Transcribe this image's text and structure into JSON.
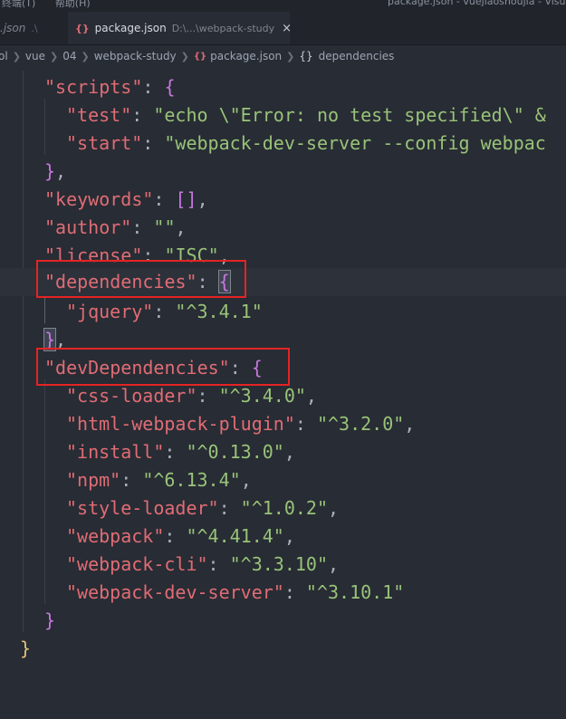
{
  "menubar": {
    "items": [
      "终端(T)",
      "帮助(H)"
    ],
    "window_title": "package.json - vuejiaoshoujia - Visual Studio Code"
  },
  "tabs": {
    "inactive": {
      "label": ".json",
      "path": ".\\"
    },
    "active": {
      "icon": "{}",
      "label": "package.json",
      "path": "D:\\...\\webpack-study",
      "close": "×"
    }
  },
  "breadcrumb": {
    "items": [
      "ol",
      "vue",
      "04",
      "webpack-study"
    ],
    "file": "package.json",
    "file_icon": "{}",
    "symbol_icon": "{}",
    "symbol": "dependencies"
  },
  "code": {
    "scripts_key": "\"scripts\"",
    "test_key": "\"test\"",
    "test_value": "\"echo \\\"Error: no test specified\\\" &",
    "start_key": "\"start\"",
    "start_value": "\"webpack-dev-server --config webpac",
    "keywords_key": "\"keywords\"",
    "author_key": "\"author\"",
    "author_value": "\"\"",
    "license_key": "\"license\"",
    "license_value": "\"ISC\"",
    "dependencies_key": "\"dependencies\"",
    "jquery_key": "\"jquery\"",
    "jquery_value": "\"^3.4.1\"",
    "devdeps_key": "\"devDependencies\"",
    "dev": [
      {
        "key": "\"css-loader\"",
        "value": "\"^3.4.0\"",
        "comma": ","
      },
      {
        "key": "\"html-webpack-plugin\"",
        "value": "\"^3.2.0\"",
        "comma": ","
      },
      {
        "key": "\"install\"",
        "value": "\"^0.13.0\"",
        "comma": ","
      },
      {
        "key": "\"npm\"",
        "value": "\"^6.13.4\"",
        "comma": ","
      },
      {
        "key": "\"style-loader\"",
        "value": "\"^1.0.2\"",
        "comma": ","
      },
      {
        "key": "\"webpack\"",
        "value": "\"^4.41.4\"",
        "comma": ","
      },
      {
        "key": "\"webpack-cli\"",
        "value": "\"^3.3.10\"",
        "comma": ","
      },
      {
        "key": "\"webpack-dev-server\"",
        "value": "\"^3.10.1\"",
        "comma": ""
      }
    ]
  },
  "colors": {
    "key": "#e06c75",
    "string": "#98c379",
    "bracket_inner": "#c678dd",
    "bracket_outer": "#e5c07b",
    "annotation": "#e52323"
  }
}
